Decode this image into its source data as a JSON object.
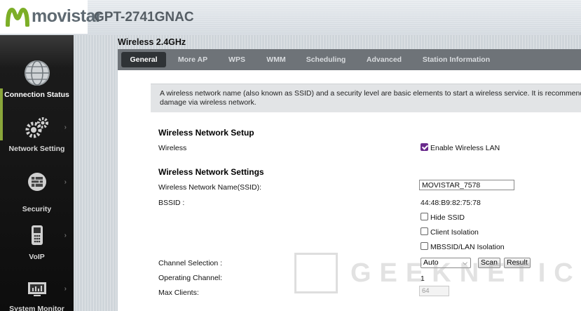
{
  "header": {
    "brand": "movistar",
    "model": "GPT-2741GNAC"
  },
  "sidebar": {
    "items": [
      {
        "label": "Connection Status",
        "icon": "globe-icon",
        "active": true
      },
      {
        "label": "Network Setting",
        "icon": "gears-icon",
        "active": false
      },
      {
        "label": "Security",
        "icon": "firewall-icon",
        "active": false
      },
      {
        "label": "VoIP",
        "icon": "phone-icon",
        "active": false
      },
      {
        "label": "System Monitor",
        "icon": "monitor-icon",
        "active": false
      }
    ]
  },
  "page": {
    "title": "Wireless 2.4GHz"
  },
  "tabs": [
    {
      "label": "General",
      "active": true
    },
    {
      "label": "More AP",
      "active": false
    },
    {
      "label": "WPS",
      "active": false
    },
    {
      "label": "WMM",
      "active": false
    },
    {
      "label": "Scheduling",
      "active": false
    },
    {
      "label": "Advanced",
      "active": false
    },
    {
      "label": "Station Information",
      "active": false
    }
  ],
  "info": {
    "line1": "A wireless network name (also known as SSID) and a security level are basic elements to start a wireless service. It is recommende",
    "line2": "damage via wireless network."
  },
  "setup": {
    "heading": "Wireless Network Setup",
    "wireless_label": "Wireless",
    "enable_label": "Enable Wireless LAN",
    "enable_checked": true
  },
  "settings": {
    "heading": "Wireless Network Settings",
    "ssid_label": "Wireless Network Name(SSID):",
    "ssid_value": "MOVISTAR_7578",
    "bssid_label": "BSSID :",
    "bssid_value": "44:48:B9:82:75:78",
    "hide_ssid_label": "Hide SSID",
    "client_isolation_label": "Client Isolation",
    "mbssid_label": "MBSSID/LAN Isolation",
    "channel_selection_label": "Channel Selection :",
    "channel_selection_value": "Auto",
    "scan_label": "Scan",
    "result_label": "Result",
    "operating_channel_label": "Operating Channel:",
    "operating_channel_value": "1",
    "max_clients_label": "Max Clients:",
    "max_clients_value": "64"
  },
  "watermark": {
    "text": "GEEKNETIC"
  },
  "colors": {
    "accent_purple": "#6a2a8c",
    "brand_green": "#8aa63a",
    "sidebar_bg": "#0d0d0d",
    "tabbar_bg": "#6e7378"
  }
}
